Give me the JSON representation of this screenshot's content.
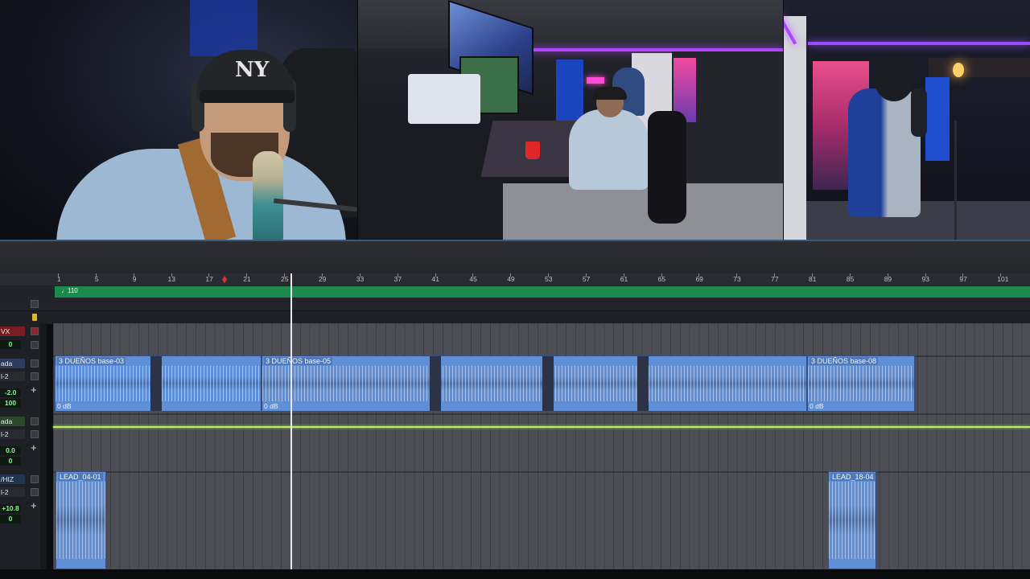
{
  "cams": {
    "cam1_logo": "NY"
  },
  "ruler": {
    "ticks": [
      "1",
      "5",
      "9",
      "13",
      "17",
      "21",
      "25",
      "29",
      "33",
      "37",
      "41",
      "45",
      "49",
      "53",
      "57",
      "61",
      "65",
      "69",
      "73",
      "77",
      "81",
      "85",
      "89",
      "93",
      "97",
      "101"
    ]
  },
  "tempo": {
    "label": "♩110"
  },
  "tracks": [
    {
      "name": "VX",
      "headers": [
        "0"
      ]
    },
    {
      "name": "ada",
      "sub": "l-2",
      "volume": "-2.0",
      "pan": "100",
      "clips": [
        {
          "name": "3 DUEÑOS base-03",
          "gain": "0 dB"
        },
        {
          "name": "3 DUEÑOS base-05",
          "gain": "0 dB"
        },
        {
          "name": "3 DUEÑOS base-08",
          "gain": "0 dB"
        }
      ]
    },
    {
      "name": "ada",
      "sub": "l-2",
      "volume": "0.0",
      "pan": "0"
    },
    {
      "name": "/HIZ",
      "sub": "l-2",
      "volume": "+10.8",
      "pan": "0",
      "clips": [
        {
          "name": "LEAD_04-01"
        },
        {
          "name": "LEAD_18-04"
        }
      ]
    }
  ],
  "colors": {
    "clip": "#5f8fd6",
    "tempo": "#1c8a4c",
    "automation": "#b8f060",
    "playhead_marker": "#e03030"
  }
}
